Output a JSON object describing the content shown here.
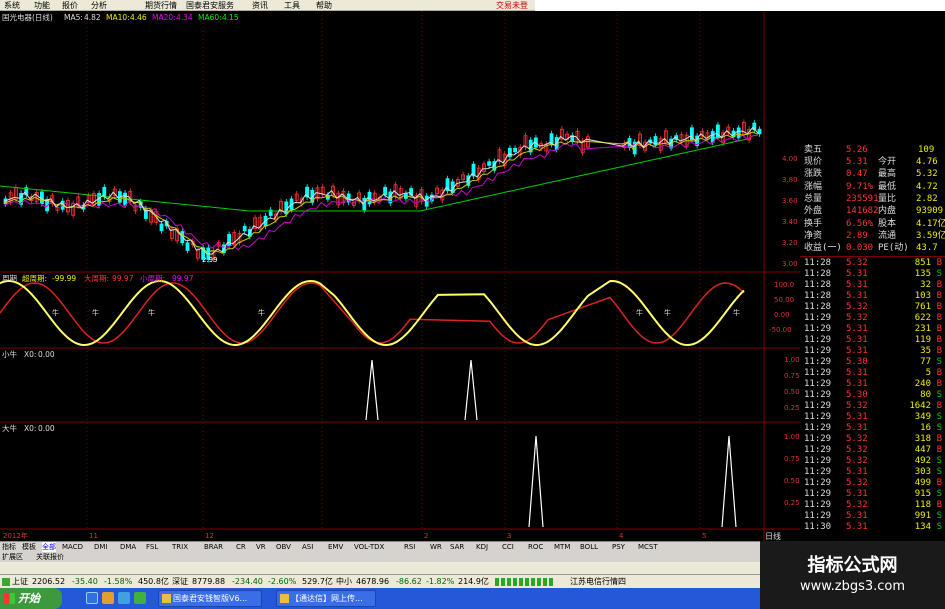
{
  "menu": {
    "items": [
      "系统",
      "功能",
      "报价",
      "分析",
      "期货行情",
      "国泰君安服务",
      "资讯",
      "工具",
      "帮助"
    ],
    "trade_link": "交易未登"
  },
  "colors": {
    "up": "#ff3333",
    "down": "#00ffff",
    "ma5": "#ffffff",
    "ma10": "#ffff00",
    "ma20": "#ff00ff",
    "ma60": "#00ff00",
    "grid": "#800000"
  },
  "price_panel": {
    "stock_name": "国光电器(日线)",
    "ma5_label": "MA5:",
    "ma5": "4.82",
    "ma10_label": "MA10:",
    "ma10": "4.46",
    "ma20_label": "MA20:",
    "ma20": "4.34",
    "ma60_label": "MA60:",
    "ma60": "4.15",
    "low_marker": "2.99",
    "y_ticks": [
      "4.00",
      "3.80",
      "3.60",
      "3.40",
      "3.20",
      "3.00"
    ]
  },
  "cycle_panel": {
    "title": "周期",
    "super_label": "超周期:",
    "super_value": "-99.99",
    "big_label": "大周期:",
    "big_value": "99.97",
    "small_label": "小周期:",
    "small_value": "99.97",
    "y_ticks": [
      "100.0",
      "50.00",
      "0.00",
      "-50.00"
    ],
    "cow_label": "牛"
  },
  "small_cow_panel": {
    "title": "小牛",
    "x0_label": "X0:",
    "x0_value": "0.00",
    "y_ticks": [
      "1.00",
      "0.75",
      "0.50",
      "0.25"
    ]
  },
  "big_cow_panel": {
    "title": "大牛",
    "x0_label": "X0:",
    "x0_value": "0.00",
    "y_ticks": [
      "1.00",
      "0.75",
      "0.50",
      "0.25"
    ]
  },
  "time_axis": {
    "start": "2012年",
    "months": [
      "11",
      "12",
      "2",
      "3",
      "4",
      "5"
    ],
    "period": "日线"
  },
  "quote": {
    "ask5_label": "卖五",
    "ask5": "5.26",
    "ask5_vol": "109",
    "stats": [
      {
        "l1": "现价",
        "v1": "5.31",
        "l2": "今开",
        "v2": "4.76"
      },
      {
        "l1": "涨跌",
        "v1": "0.47",
        "l2": "最高",
        "v2": "5.32"
      },
      {
        "l1": "涨幅",
        "v1": "9.71%",
        "l2": "最低",
        "v2": "4.72"
      },
      {
        "l1": "总量",
        "v1": "235591",
        "l2": "量比",
        "v2": "2.82"
      },
      {
        "l1": "外盘",
        "v1": "141682",
        "l2": "内盘",
        "v2": "93909"
      },
      {
        "l1": "换手",
        "v1": "6.56%",
        "l2": "股本",
        "v2": "4.17亿"
      },
      {
        "l1": "净资",
        "v1": "2.89",
        "l2": "流通",
        "v2": "3.59亿"
      },
      {
        "l1": "收益(一)",
        "v1": "0.030",
        "l2": "PE(动)",
        "v2": "43.7"
      }
    ],
    "ticks": [
      {
        "t": "11:28",
        "p": "5.32",
        "v": "851",
        "s": "B"
      },
      {
        "t": "11:28",
        "p": "5.31",
        "v": "135",
        "s": "S"
      },
      {
        "t": "11:28",
        "p": "5.31",
        "v": "32",
        "s": "B"
      },
      {
        "t": "11:28",
        "p": "5.31",
        "v": "103",
        "s": "B"
      },
      {
        "t": "11:28",
        "p": "5.32",
        "v": "761",
        "s": "B"
      },
      {
        "t": "11:29",
        "p": "5.32",
        "v": "622",
        "s": "B"
      },
      {
        "t": "11:29",
        "p": "5.31",
        "v": "231",
        "s": "B"
      },
      {
        "t": "11:29",
        "p": "5.31",
        "v": "119",
        "s": "B"
      },
      {
        "t": "11:29",
        "p": "5.31",
        "v": "35",
        "s": "B"
      },
      {
        "t": "11:29",
        "p": "5.30",
        "v": "77",
        "s": "S"
      },
      {
        "t": "11:29",
        "p": "5.31",
        "v": "5",
        "s": "B"
      },
      {
        "t": "11:29",
        "p": "5.31",
        "v": "240",
        "s": "B"
      },
      {
        "t": "11:29",
        "p": "5.30",
        "v": "80",
        "s": "S"
      },
      {
        "t": "11:29",
        "p": "5.32",
        "v": "1642",
        "s": "B"
      },
      {
        "t": "11:29",
        "p": "5.31",
        "v": "349",
        "s": "S"
      },
      {
        "t": "11:29",
        "p": "5.31",
        "v": "16",
        "s": "S"
      },
      {
        "t": "11:29",
        "p": "5.32",
        "v": "318",
        "s": "B"
      },
      {
        "t": "11:29",
        "p": "5.32",
        "v": "447",
        "s": "B"
      },
      {
        "t": "11:29",
        "p": "5.32",
        "v": "492",
        "s": "S"
      },
      {
        "t": "11:29",
        "p": "5.31",
        "v": "303",
        "s": "S"
      },
      {
        "t": "11:29",
        "p": "5.32",
        "v": "499",
        "s": "B"
      },
      {
        "t": "11:29",
        "p": "5.31",
        "v": "915",
        "s": "S"
      },
      {
        "t": "11:29",
        "p": "5.32",
        "v": "118",
        "s": "B"
      },
      {
        "t": "11:29",
        "p": "5.31",
        "v": "991",
        "s": "S"
      },
      {
        "t": "11:30",
        "p": "5.31",
        "v": "134",
        "s": "S"
      }
    ]
  },
  "tabs": [
    "指标",
    "模板",
    "全部",
    "MACD",
    "DMI",
    "DMA",
    "FSL",
    "TRIX",
    "BRAR",
    "CR",
    "VR",
    "OBV",
    "ASI",
    "EMV",
    "VOL-TDX",
    "RSI",
    "WR",
    "SAR",
    "KDJ",
    "CCI",
    "ROC",
    "MTM",
    "BOLL",
    "PSY",
    "MCST"
  ],
  "tabs2": [
    "扩展区",
    "关联报价"
  ],
  "status": {
    "sh_label": "上证",
    "sh_val": "2206.52",
    "sh_chg": "-35.40",
    "sh_pct": "-1.58%",
    "sh_amt": "450.8亿",
    "sz_label": "深证",
    "sz_val": "8779.88",
    "sz_chg": "-234.40",
    "sz_pct": "-2.60%",
    "sz_amt": "529.7亿",
    "zx_label": "中小",
    "zx_val": "4678.96",
    "zx_chg": "-86.62",
    "zx_pct": "-1.82%",
    "zx_amt": "214.9亿",
    "broker": "江苏电信行情四"
  },
  "taskbar": {
    "start": "开始",
    "tasks": [
      "国泰君安钱智版V6...",
      "【通达信】网上传..."
    ]
  },
  "watermark": {
    "title": "指标公式网",
    "url": "www.zbgs3.com"
  }
}
